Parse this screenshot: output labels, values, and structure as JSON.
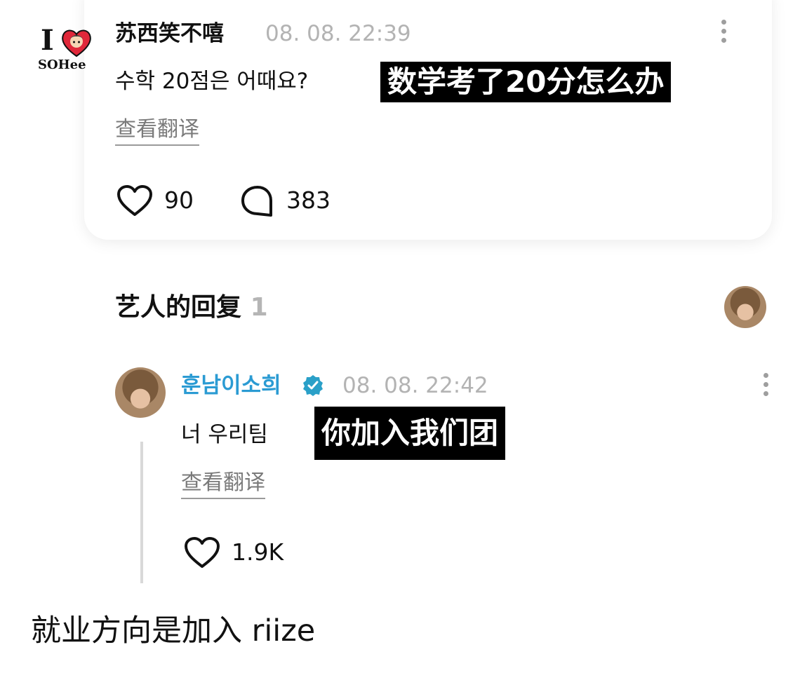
{
  "top_comment": {
    "logo": {
      "glyph": "I",
      "text": "SOHee"
    },
    "username": "苏西笑不嘻",
    "timestamp": "08. 08. 22:39",
    "text": "수학 20점은 어때요?",
    "subtitle": "数学考了20分怎么办",
    "translate_label": "查看翻译",
    "likes": "90",
    "replies": "383",
    "icons": {
      "like": "heart-icon",
      "reply": "comment-bubble-icon",
      "more": "more-vertical-icon"
    }
  },
  "artist_replies": {
    "title": "艺人的回复",
    "count": "1"
  },
  "reply": {
    "username": "훈남이소희",
    "timestamp": "08. 08. 22:42",
    "text": "너 우리팀",
    "subtitle": "你加入我们团",
    "translate_label": "查看翻译",
    "likes": "1.9K",
    "icons": {
      "verified": "verified-badge-icon",
      "like": "heart-icon",
      "more": "more-vertical-icon"
    }
  },
  "caption": "就业方向是加入 riize",
  "colors": {
    "username_blue": "#2b9bd3",
    "verified": "#2aa0c8",
    "subtitle_bg": "#000000",
    "muted": "#b3b3b3"
  }
}
